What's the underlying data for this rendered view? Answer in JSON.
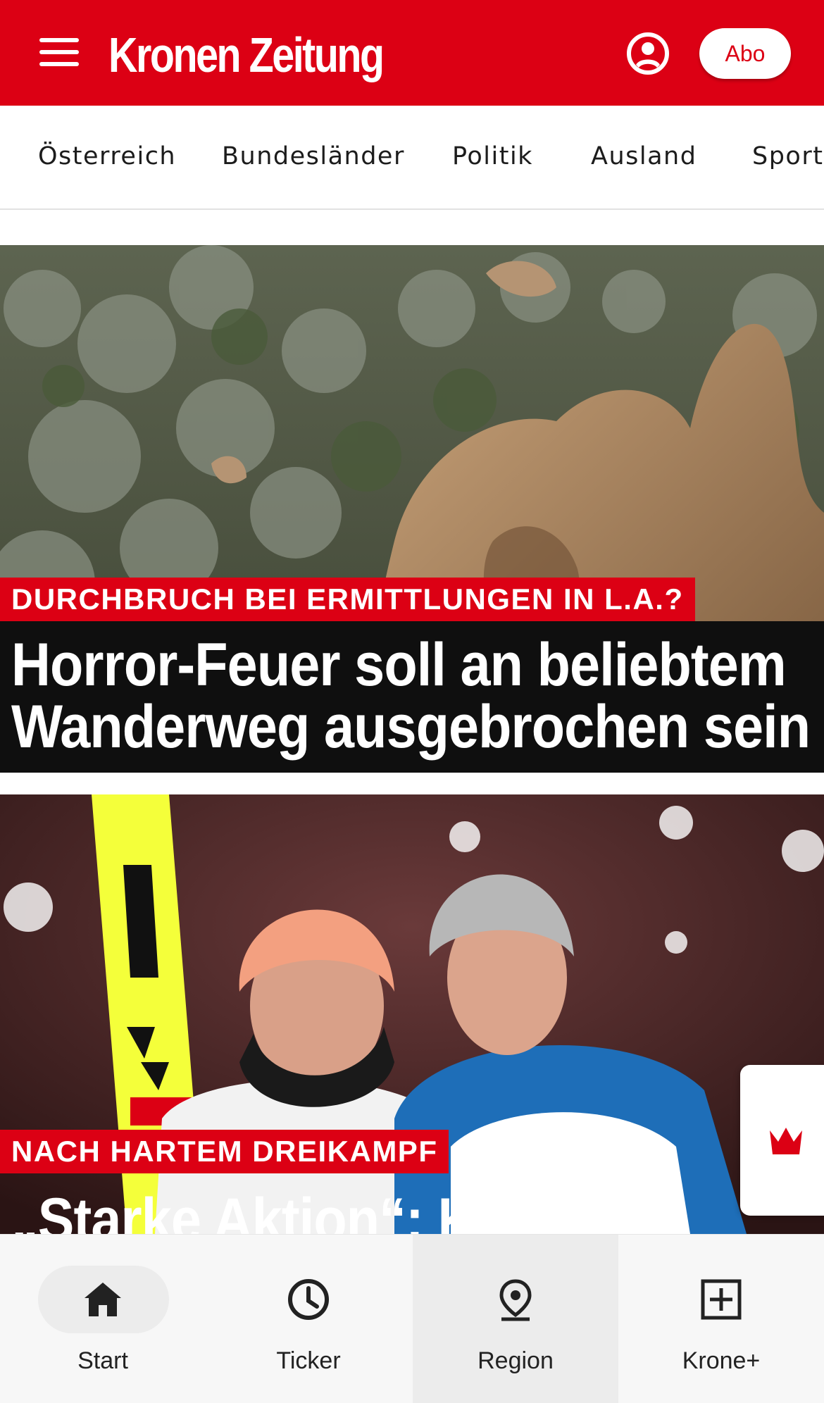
{
  "colors": {
    "brand_red": "#dc0014",
    "headline_bg": "#0f0f0f",
    "nav_bg": "#f7f7f7"
  },
  "header": {
    "logo": "Kronen Zeitung",
    "menu_icon": "hamburger-menu-icon",
    "account_icon": "account-circle-icon",
    "abo_label": "Abo"
  },
  "categories": [
    "Österreich",
    "Bundesländer",
    "Politik",
    "Ausland",
    "Sport"
  ],
  "articles": [
    {
      "kicker": "DURCHBRUCH BEI ERMITTLUNGEN IN L.A.?",
      "headline_line1": "Horror-Feuer soll an beliebtem",
      "headline_line2": "Wanderweg ausgebrochen sein",
      "image": "rocky-hillside-photo"
    },
    {
      "kicker": "NACH HARTEM DREIKAMPF",
      "headline_line1": "„Starke Aktion“: Kraft",
      "image": "ski-jumpers-photo"
    }
  ],
  "kroneplus_tab_icon": "krone-crown-icon",
  "bottom_nav": [
    {
      "label": "Start",
      "icon": "home-icon",
      "active": true
    },
    {
      "label": "Ticker",
      "icon": "clock-icon",
      "active": false
    },
    {
      "label": "Region",
      "icon": "location-pin-icon",
      "active": false
    },
    {
      "label": "Krone+",
      "icon": "plus-box-icon",
      "active": false
    }
  ]
}
